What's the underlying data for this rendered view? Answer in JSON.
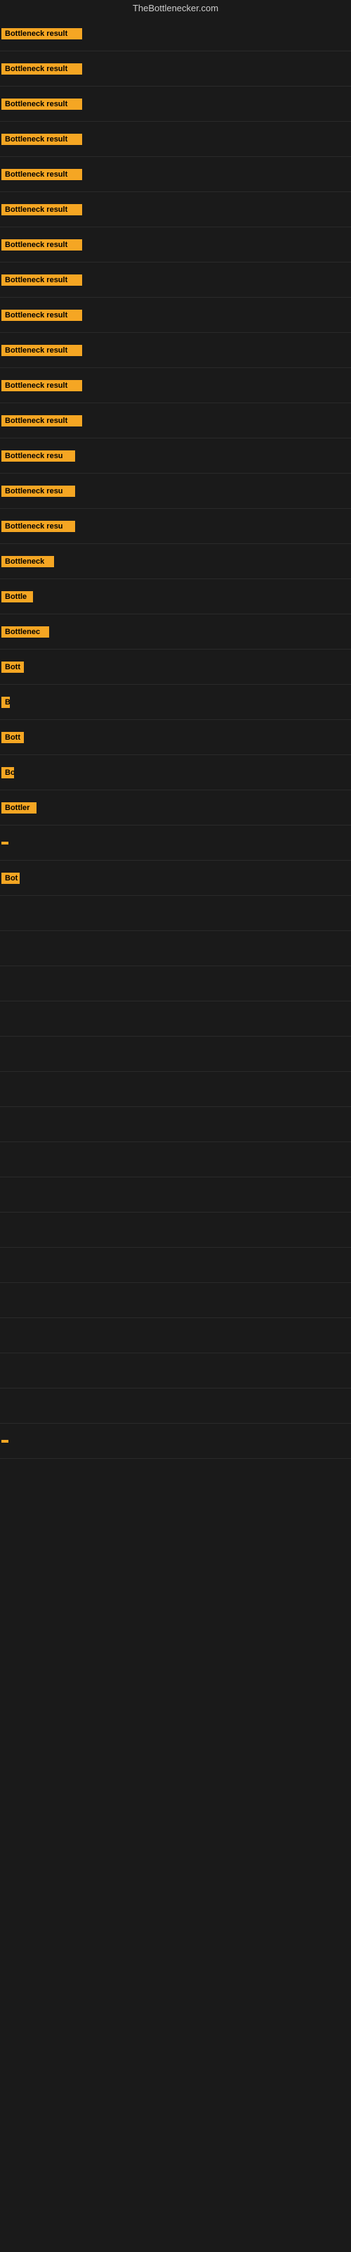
{
  "site_title": "TheBottlenecker.com",
  "badge_label": "Bottleneck result",
  "rows": [
    {
      "badge_text": "Bottleneck result",
      "badge_width": 115
    },
    {
      "badge_text": "Bottleneck result",
      "badge_width": 115
    },
    {
      "badge_text": "Bottleneck result",
      "badge_width": 115
    },
    {
      "badge_text": "Bottleneck result",
      "badge_width": 115
    },
    {
      "badge_text": "Bottleneck result",
      "badge_width": 115
    },
    {
      "badge_text": "Bottleneck result",
      "badge_width": 115
    },
    {
      "badge_text": "Bottleneck result",
      "badge_width": 115
    },
    {
      "badge_text": "Bottleneck result",
      "badge_width": 115
    },
    {
      "badge_text": "Bottleneck result",
      "badge_width": 115
    },
    {
      "badge_text": "Bottleneck result",
      "badge_width": 115
    },
    {
      "badge_text": "Bottleneck result",
      "badge_width": 115
    },
    {
      "badge_text": "Bottleneck result",
      "badge_width": 115
    },
    {
      "badge_text": "Bottleneck resu",
      "badge_width": 105
    },
    {
      "badge_text": "Bottleneck resu",
      "badge_width": 105
    },
    {
      "badge_text": "Bottleneck resu",
      "badge_width": 105
    },
    {
      "badge_text": "Bottleneck",
      "badge_width": 75
    },
    {
      "badge_text": "Bottle",
      "badge_width": 45
    },
    {
      "badge_text": "Bottlenec",
      "badge_width": 68
    },
    {
      "badge_text": "Bott",
      "badge_width": 32
    },
    {
      "badge_text": "B",
      "badge_width": 12
    },
    {
      "badge_text": "Bott",
      "badge_width": 32
    },
    {
      "badge_text": "Bo",
      "badge_width": 18
    },
    {
      "badge_text": "Bottler",
      "badge_width": 50
    },
    {
      "badge_text": "",
      "badge_width": 4
    },
    {
      "badge_text": "Bot",
      "badge_width": 26
    },
    {
      "badge_text": "",
      "badge_width": 0
    },
    {
      "badge_text": "",
      "badge_width": 0
    },
    {
      "badge_text": "",
      "badge_width": 0
    },
    {
      "badge_text": "",
      "badge_width": 0
    },
    {
      "badge_text": "",
      "badge_width": 0
    },
    {
      "badge_text": "",
      "badge_width": 0
    },
    {
      "badge_text": "",
      "badge_width": 0
    },
    {
      "badge_text": "",
      "badge_width": 0
    },
    {
      "badge_text": "",
      "badge_width": 0
    },
    {
      "badge_text": "",
      "badge_width": 0
    },
    {
      "badge_text": "",
      "badge_width": 0
    },
    {
      "badge_text": "",
      "badge_width": 0
    },
    {
      "badge_text": "",
      "badge_width": 0
    },
    {
      "badge_text": "",
      "badge_width": 0
    },
    {
      "badge_text": "",
      "badge_width": 0
    },
    {
      "badge_text": "",
      "badge_width": 4
    }
  ]
}
